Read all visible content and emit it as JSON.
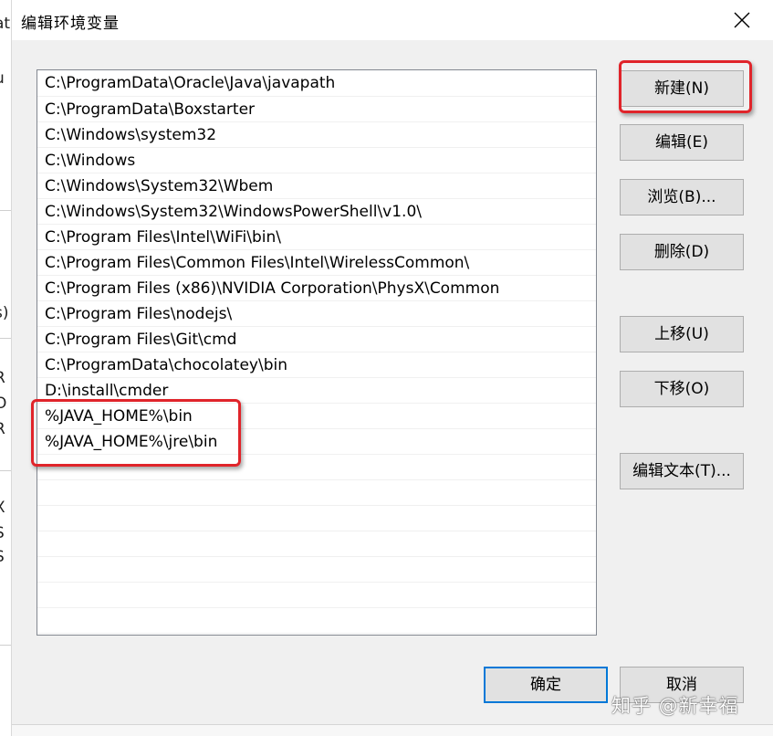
{
  "dialog": {
    "title": "编辑环境变量"
  },
  "path_list": {
    "items": [
      "C:\\ProgramData\\Oracle\\Java\\javapath",
      "C:\\ProgramData\\Boxstarter",
      "C:\\Windows\\system32",
      "C:\\Windows",
      "C:\\Windows\\System32\\Wbem",
      "C:\\Windows\\System32\\WindowsPowerShell\\v1.0\\",
      "C:\\Program Files\\Intel\\WiFi\\bin\\",
      "C:\\Program Files\\Common Files\\Intel\\WirelessCommon\\",
      "C:\\Program Files (x86)\\NVIDIA Corporation\\PhysX\\Common",
      "C:\\Program Files\\nodejs\\",
      "C:\\Program Files\\Git\\cmd",
      "C:\\ProgramData\\chocolatey\\bin",
      "D:\\install\\cmder",
      "%JAVA_HOME%\\bin",
      "%JAVA_HOME%\\jre\\bin",
      "",
      "",
      "",
      "",
      "",
      "",
      ""
    ]
  },
  "buttons": {
    "new": "新建(N)",
    "edit": "编辑(E)",
    "browse": "浏览(B)...",
    "delete": "删除(D)",
    "move_up": "上移(U)",
    "move_down": "下移(O)",
    "edit_text": "编辑文本(T)...",
    "ok": "确定",
    "cancel": "取消"
  },
  "background_fragments": [
    "at",
    "u",
    "s)",
    "R",
    "O",
    "R",
    "X",
    "S",
    "S"
  ],
  "watermark": "知乎 @新幸福",
  "colors": {
    "highlight": "#e0242a",
    "primary_border": "#0078d7",
    "button_bg": "#e1e1e1",
    "dialog_bg": "#f0f0f0"
  }
}
